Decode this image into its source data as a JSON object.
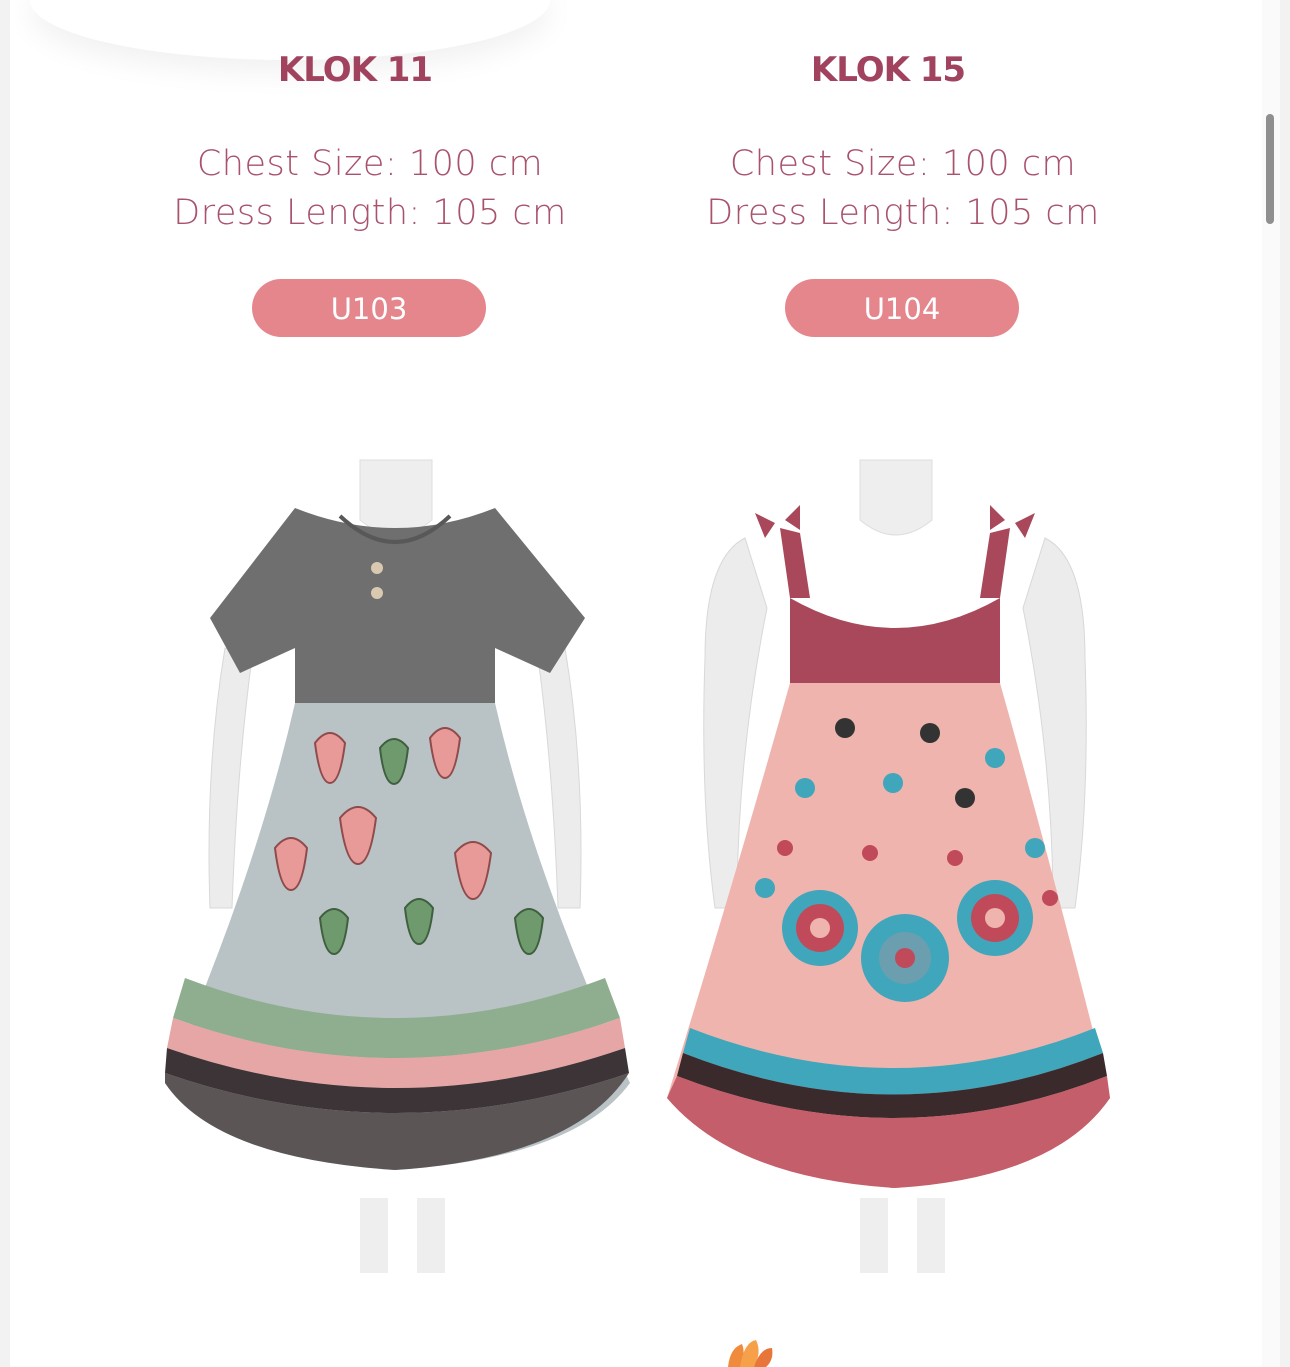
{
  "products": [
    {
      "title": "KLOK 11",
      "chest": "Chest Size: 100 cm",
      "length": "Dress Length: 105 cm",
      "code": "U103",
      "image_alt": "grey-tulip-print-dress",
      "colors": {
        "bodice": "#6f6f6f",
        "skirt": "#b9c3c5",
        "motif": "#e89a98",
        "leaf": "#6e9a6e",
        "hem": "#5b5556"
      }
    },
    {
      "title": "KLOK 15",
      "chest": "Chest Size: 100 cm",
      "length": "Dress Length: 105 cm",
      "code": "U104",
      "image_alt": "pink-floral-print-dress",
      "colors": {
        "bodice": "#a8485a",
        "skirt": "#efb4ae",
        "motif": "#3fa6bb",
        "leaf": "#c04a5a",
        "hem": "#c35e6a"
      }
    }
  ],
  "theme": {
    "title_color": "#a1425e",
    "text_color": "#a8526b",
    "button_color": "#e5868d"
  },
  "icons": {
    "decoration": "flower-icon"
  }
}
